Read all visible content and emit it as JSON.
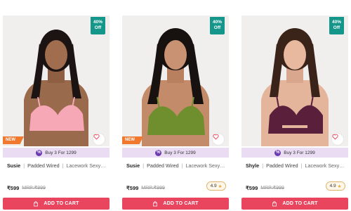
{
  "colors": {
    "accent": "#e9455f",
    "discount": "#15968a",
    "offer_bg": "#e9dcf3",
    "new_badge": "#f0782f",
    "rating_border": "#e0b26b"
  },
  "products": [
    {
      "discount_line1": "40%",
      "discount_line2": "Off",
      "new_badge": "NEW",
      "offer_text": "Buy 3 For 1299",
      "name": "Susie",
      "tag": "Padded Wired",
      "desc": "Lacework Sexy Half Cov...",
      "price": "₹599",
      "mrp": "MRP:₹999",
      "rating": "",
      "cart_label": "ADD TO CART",
      "bra_color": "#f6a8b6",
      "wishlist_icon": "heart-icon"
    },
    {
      "discount_line1": "40%",
      "discount_line2": "Off",
      "new_badge": "NEW",
      "offer_text": "Buy 3 For 1299",
      "name": "Susie",
      "tag": "Padded Wired",
      "desc": "Lacework Sexy Half Cov...",
      "price": "₹599",
      "mrp": "MRP:₹999",
      "rating": "4.9",
      "cart_label": "ADD TO CART",
      "bra_color": "#6f8f2f",
      "wishlist_icon": "heart-icon"
    },
    {
      "discount_line1": "40%",
      "discount_line2": "Off",
      "new_badge": "",
      "offer_text": "Buy 3 For 1299",
      "name": "Shyle",
      "tag": "Padded Wired",
      "desc": "Lacework Sexy Half Cov...",
      "price": "₹599",
      "mrp": "MRP:₹999",
      "rating": "4.9",
      "cart_label": "ADD TO CART",
      "bra_color": "#5a1f3a",
      "wishlist_icon": "heart-icon"
    }
  ]
}
